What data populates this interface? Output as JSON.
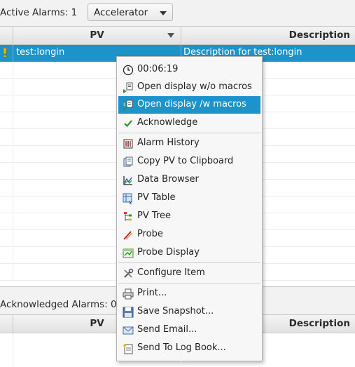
{
  "toolbar": {
    "active_label": "Active Alarms: 1",
    "filter_value": "Accelerator"
  },
  "active_table": {
    "columns": [
      "",
      "PV",
      "Description"
    ],
    "rows": [
      {
        "pv": "test:longin",
        "description": "Description for test:longin",
        "severity": "minor"
      }
    ]
  },
  "ack_section": {
    "label": "Acknowledged Alarms: 0",
    "columns": [
      "",
      "PV",
      "Description"
    ]
  },
  "context_menu": {
    "items": [
      {
        "label": "00:06:19",
        "icon": "clock-icon"
      },
      {
        "label": "Open display w/o macros",
        "icon": "open-display-icon"
      },
      {
        "label": "Open display /w macros",
        "icon": "open-display-macros-icon",
        "highlighted": true
      },
      {
        "label": "Acknowledge",
        "icon": "checkmark-icon"
      },
      {
        "label": "Alarm History",
        "icon": "alarm-history-icon"
      },
      {
        "label": "Copy PV to Clipboard",
        "icon": "copy-icon"
      },
      {
        "label": "Data Browser",
        "icon": "data-browser-icon"
      },
      {
        "label": "PV Table",
        "icon": "pv-table-icon"
      },
      {
        "label": "PV Tree",
        "icon": "pv-tree-icon"
      },
      {
        "label": "Probe",
        "icon": "probe-icon"
      },
      {
        "label": "Probe Display",
        "icon": "probe-display-icon"
      },
      {
        "label": "Configure Item",
        "icon": "configure-icon"
      },
      {
        "label": "Print...",
        "icon": "print-icon"
      },
      {
        "label": "Save Snapshot...",
        "icon": "save-icon"
      },
      {
        "label": "Send Email...",
        "icon": "email-icon"
      },
      {
        "label": "Send To Log Book...",
        "icon": "logbook-icon"
      }
    ]
  },
  "colors": {
    "selection": "#1c93c9",
    "warning": "#e6b800",
    "check": "#2a9a2a"
  }
}
